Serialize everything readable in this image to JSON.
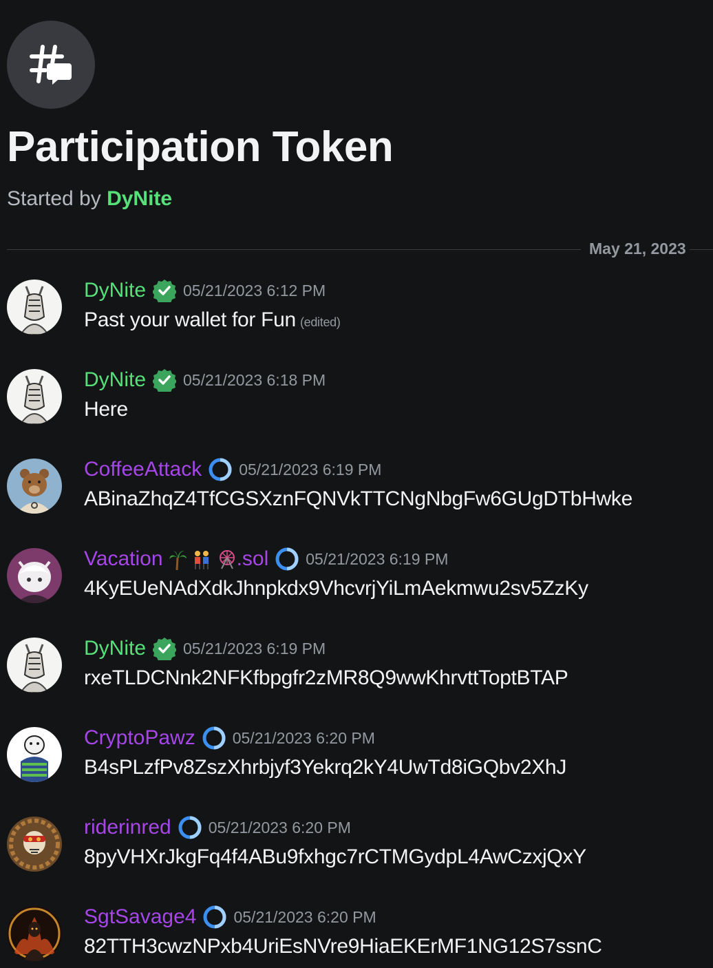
{
  "thread": {
    "title": "Participation Token",
    "started_by_prefix": "Started by ",
    "started_by_author": "DyNite",
    "icon": "thread-icon"
  },
  "divider": {
    "date": "May 21, 2023"
  },
  "colors": {
    "background": "#131416",
    "green_name": "#57e07a",
    "purple_name": "#a646e8",
    "verified_badge": "#3ba55d",
    "ring_badge": "#3c8ef0"
  },
  "messages": [
    {
      "username": "DyNite",
      "name_color": "green",
      "badge": "verified-check-icon",
      "timestamp": "05/21/2023 6:12 PM",
      "text": "Past your wallet for Fun",
      "edited_label": "(edited)"
    },
    {
      "username": "DyNite",
      "name_color": "green",
      "badge": "verified-check-icon",
      "timestamp": "05/21/2023 6:18 PM",
      "text": "Here"
    },
    {
      "username": "CoffeeAttack",
      "name_color": "purple",
      "badge": "ring-badge-icon",
      "timestamp": "05/21/2023 6:19 PM",
      "text": "ABinaZhqZ4TfCGSXznFQNVkTTCNgNbgFw6GUgDTbHwke"
    },
    {
      "username": "Vacation",
      "username_suffix": ".sol",
      "name_emojis": [
        "palm-tree-icon",
        "couple-icon",
        "ferris-wheel-icon"
      ],
      "name_color": "purple",
      "badge": "ring-badge-icon",
      "timestamp": "05/21/2023 6:19 PM",
      "text": "4KyEUeNAdXdkJhnpkdx9VhcvrjYiLmAekmwu2sv5ZzKy"
    },
    {
      "username": "DyNite",
      "name_color": "green",
      "badge": "verified-check-icon",
      "timestamp": "05/21/2023 6:19 PM",
      "text": "rxeTLDCNnk2NFKfbpgfr2zMR8Q9wwKhrvttToptBTAP"
    },
    {
      "username": "CryptoPawz",
      "name_color": "purple",
      "badge": "ring-badge-icon",
      "timestamp": "05/21/2023 6:20 PM",
      "text": "B4sPLzfPv8ZszXhrbjyf3Yekrq2kY4UwTd8iGQbv2XhJ"
    },
    {
      "username": "riderinred",
      "name_color": "purple",
      "badge": "ring-badge-icon",
      "timestamp": "05/21/2023 6:20 PM",
      "text": "8pyVHXrJkgFq4f4ABu9fxhgc7rCTMGydpL4AwCzxjQxY"
    },
    {
      "username": "SgtSavage4",
      "name_color": "purple",
      "badge": "ring-badge-icon",
      "timestamp": "05/21/2023 6:20 PM",
      "text": "82TTH3cwzNPxb4UriEsNVre9HiaEKErMF1NG12S7ssnC"
    }
  ]
}
